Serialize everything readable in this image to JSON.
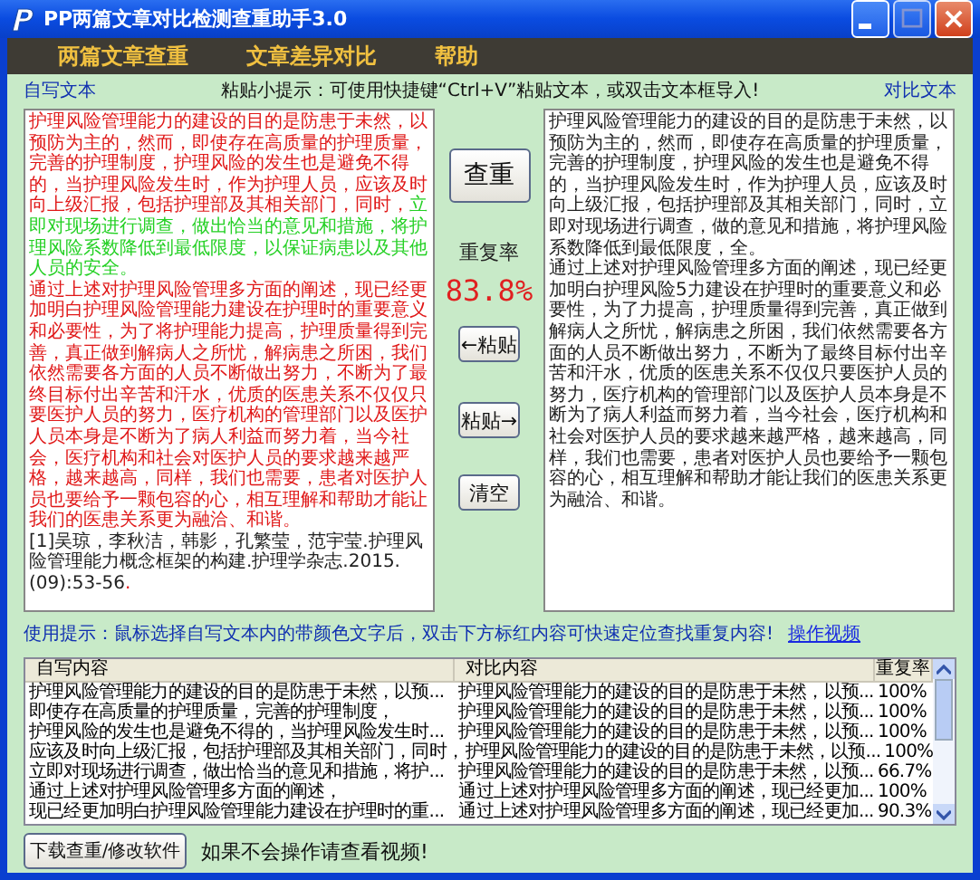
{
  "window": {
    "title": "PP两篇文章对比检测查重助手3.0"
  },
  "menu": [
    "两篇文章查重",
    "文章差异对比",
    "帮助"
  ],
  "labels": {
    "left": "自写文本",
    "tip": "粘贴小提示：可使用快捷键“Ctrl+V”粘贴文本，或双击文本框导入!",
    "right": "对比文本"
  },
  "left_text": [
    {
      "segments": [
        {
          "text": "护理风险管理能力的建设的目的是防患于未然，以预防为主的，然而，即使存在高质量的护理质量，完善的护理制度，护理风险的发生也是避免不得的，当护理风险发生时，作为护理人员，应该及时向上级汇报，包括护理部及其相关部门，同时，",
          "kind": "duplicate"
        },
        {
          "text": "立即对现场进行调查，做出恰当的意见和措施，将护理风险系数降低到最低限度，以保证病患以及其他人员的安全。",
          "kind": "similar"
        }
      ]
    },
    {
      "segments": [
        {
          "text": "通过上述对护理风险管理多方面的阐述，现已经更加明白护理风险管理能力建设在护理时的重要意义和必要性，为了将护理能力提高，护理质量得到完善，真正做到解病人之所忧，解病患之所困，我们依然需要各方面的人员不断做出努力，不断为了最终目标付出辛苦和汗水，优质的医患关系不仅仅只要医护人员的努力，医疗机构的管理部门以及医护人员本身是不断为了病人利益而努力着，当今社会，医疗机构和社会对医护人员的要求越来越严格，越来越高，同样，我们也需要，患者对医护人员也要给予一颗包容的心，相互理解和帮助才能让我们的医患关系更为融洽、和谐。",
          "kind": "duplicate"
        }
      ]
    },
    {
      "segments": [
        {
          "text": "[1]吴琼，李秋洁，韩影，孔繁莹，范宇莹.护理风险管理能力概念框架的构建.护理学杂志.2015.(09):53-56",
          "kind": "plain"
        },
        {
          "text": ".",
          "kind": "duplicate"
        }
      ]
    }
  ],
  "right_text": [
    "护理风险管理能力的建设的目的是防患于未然，以预防为主的，然而，即使存在高质量的护理质量，完善的护理制度，护理风险的发生也是避免不得的，当护理风险发生时，作为护理人员，应该及时向上级汇报，包括护理部及其相关部门，同时，立即对现场进行调查，做的意见和措施，将护理风险系数降低到最低限度，全。",
    "通过上述对护理风险管理多方面的阐述，现已经更加明白护理风险5力建设在护理时的重要意义和必要性，为了力提高，护理质量得到完善，真正做到解病人之所忧，解病患之所困，我们依然需要各方面的人员不断做出努力，不断为了最终目标付出辛苦和汗水，优质的医患关系不仅仅只要医护人员的努力，医疗机构的管理部门以及医护人员本身是不断为了病人利益而努力着，当今社会，医疗机构和社会对医护人员的要求越来越严格，越来越高，同样，我们也需要，患者对医护人员也要给予一颗包容的心，相互理解和帮助才能让我们的医患关系更为融洽、和谐。"
  ],
  "buttons": {
    "check": "查重",
    "paste_left": "←粘贴",
    "paste_right": "粘贴→",
    "clear": "清空"
  },
  "rate": {
    "label": "重复率",
    "value": "83.8%"
  },
  "hint": {
    "text": "使用提示：鼠标选择自写文本内的带颜色文字后，双击下方标红内容可快速定位查找重复内容!",
    "link": "操作视频"
  },
  "table": {
    "columns": [
      "自写内容",
      "对比内容",
      "重复率"
    ],
    "rows": [
      [
        "护理风险管理能力的建设的目的是防患于未然，以预...",
        "护理风险管理能力的建设的目的是防患于未然，以预...",
        "100%"
      ],
      [
        "即使存在高质量的护理质量，完善的护理制度，",
        "护理风险管理能力的建设的目的是防患于未然，以预...",
        "100%"
      ],
      [
        "护理风险的发生也是避免不得的，当护理风险发生时...",
        "护理风险管理能力的建设的目的是防患于未然，以预...",
        "100%"
      ],
      [
        "应该及时向上级汇报，包括护理部及其相关部门，同时，",
        "护理风险管理能力的建设的目的是防患于未然，以预...",
        "100%"
      ],
      [
        "立即对现场进行调查，做出恰当的意见和措施，将护...",
        "护理风险管理能力的建设的目的是防患于未然，以预...",
        "66.7%"
      ],
      [
        "通过上述对护理风险管理多方面的阐述，",
        "通过上述对护理风险管理多方面的阐述，现已经更加...",
        "100%"
      ],
      [
        "现已经更加明白护理风险管理能力建设在护理时的重...",
        "通过上述对护理风险管理多方面的阐述，现已经更加...",
        "90.3%"
      ]
    ]
  },
  "footer": {
    "button": "下载查重/修改软件",
    "note": "如果不会操作请查看视频!"
  }
}
